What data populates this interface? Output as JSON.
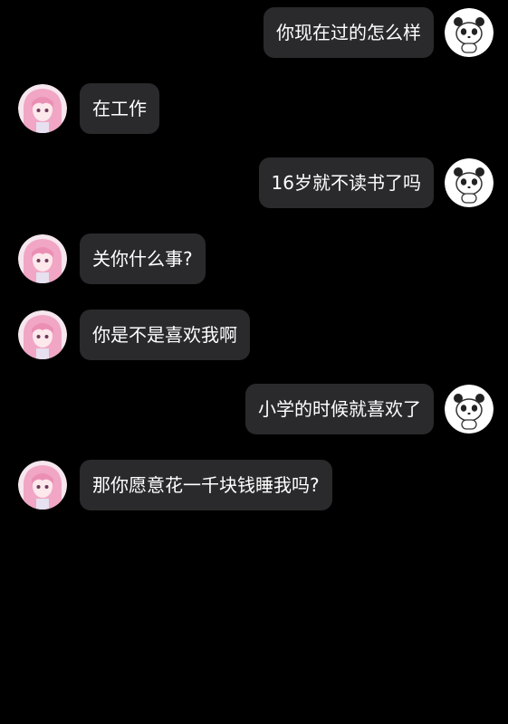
{
  "colors": {
    "background": "#000000",
    "bubble": "#2a2a2c",
    "text": "#ffffff"
  },
  "avatars": {
    "me": "panda-avatar",
    "other": "pink-hair-anime-avatar"
  },
  "messages": [
    {
      "from": "me",
      "text": "你现在过的怎么样"
    },
    {
      "from": "other",
      "text": "在工作"
    },
    {
      "from": "me",
      "text": "16岁就不读书了吗"
    },
    {
      "from": "other",
      "text": "关你什么事?"
    },
    {
      "from": "other",
      "text": "你是不是喜欢我啊"
    },
    {
      "from": "me",
      "text": "小学的时候就喜欢了"
    },
    {
      "from": "other",
      "text": "那你愿意花一千块钱睡我吗?"
    }
  ]
}
